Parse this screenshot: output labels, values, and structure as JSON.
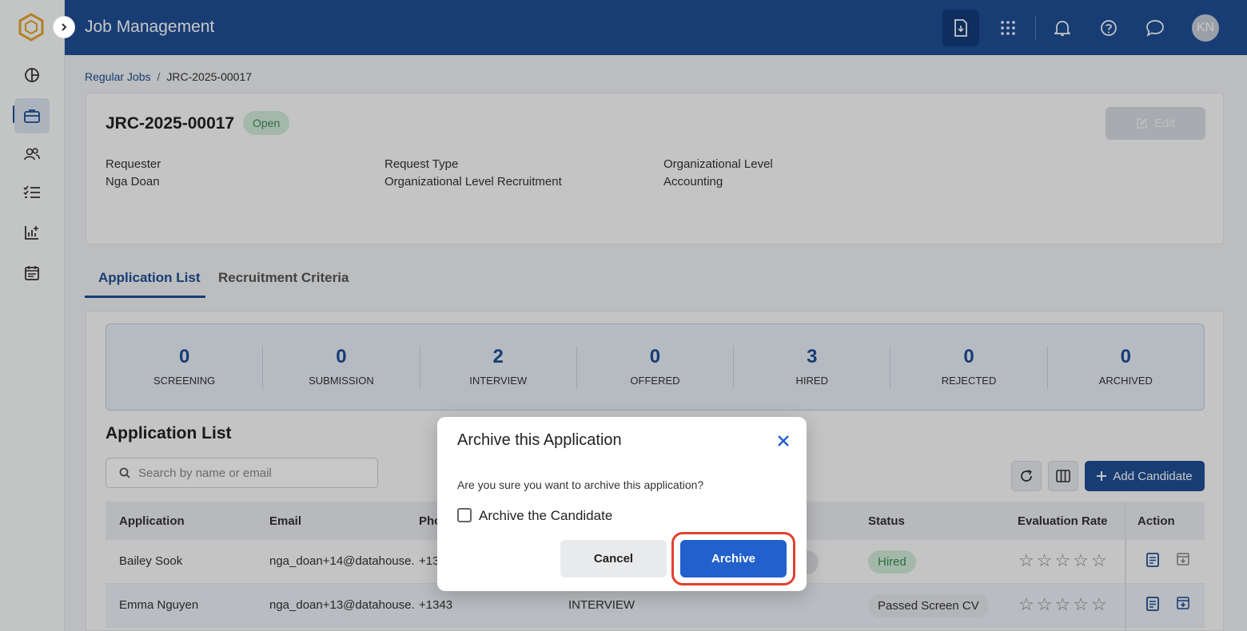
{
  "header": {
    "title": "Job Management",
    "avatar_initials": "KN"
  },
  "breadcrumb": {
    "parent": "Regular Jobs",
    "separator": "/",
    "current": "JRC-2025-00017"
  },
  "job": {
    "code": "JRC-2025-00017",
    "status": "Open",
    "edit_label": "Edit",
    "fields": [
      {
        "label": "Requester",
        "value": "Nga Doan"
      },
      {
        "label": "Request Type",
        "value": "Organizational Level Recruitment"
      },
      {
        "label": "Organizational Level",
        "value": "Accounting"
      }
    ]
  },
  "tabs": [
    {
      "label": "Application List",
      "active": true
    },
    {
      "label": "Recruitment Criteria",
      "active": false
    }
  ],
  "stats": [
    {
      "value": "0",
      "label": "SCREENING"
    },
    {
      "value": "0",
      "label": "SUBMISSION"
    },
    {
      "value": "2",
      "label": "INTERVIEW"
    },
    {
      "value": "0",
      "label": "OFFERED"
    },
    {
      "value": "3",
      "label": "HIRED"
    },
    {
      "value": "0",
      "label": "REJECTED"
    },
    {
      "value": "0",
      "label": "ARCHIVED"
    }
  ],
  "list": {
    "title": "Application List",
    "search_placeholder": "Search by name or email",
    "add_label": "Add Candidate",
    "columns": [
      "Application",
      "Email",
      "Pho",
      "Status",
      "Evaluation Rate",
      "Action"
    ],
    "rows": [
      {
        "name": "Bailey Sook",
        "email": "nga_doan+14@datahouse.",
        "phone": "+13",
        "stage": "",
        "status": "Hired",
        "rating": 0
      },
      {
        "name": "Emma Nguyen",
        "email": "nga_doan+13@datahouse.",
        "phone": "+1343",
        "stage": "INTERVIEW",
        "status": "Passed Screen CV",
        "rating": 0
      }
    ]
  },
  "modal": {
    "title": "Archive this Application",
    "message": "Are you sure you want to archive this application?",
    "checkbox_label": "Archive the Candidate",
    "checkbox_checked": false,
    "cancel_label": "Cancel",
    "archive_label": "Archive"
  },
  "colors": {
    "primary": "#1f4f97",
    "accent_button": "#2260cc",
    "highlight": "#e0412e",
    "success_bg": "#d3ecd9",
    "success_text": "#3a8c55"
  }
}
